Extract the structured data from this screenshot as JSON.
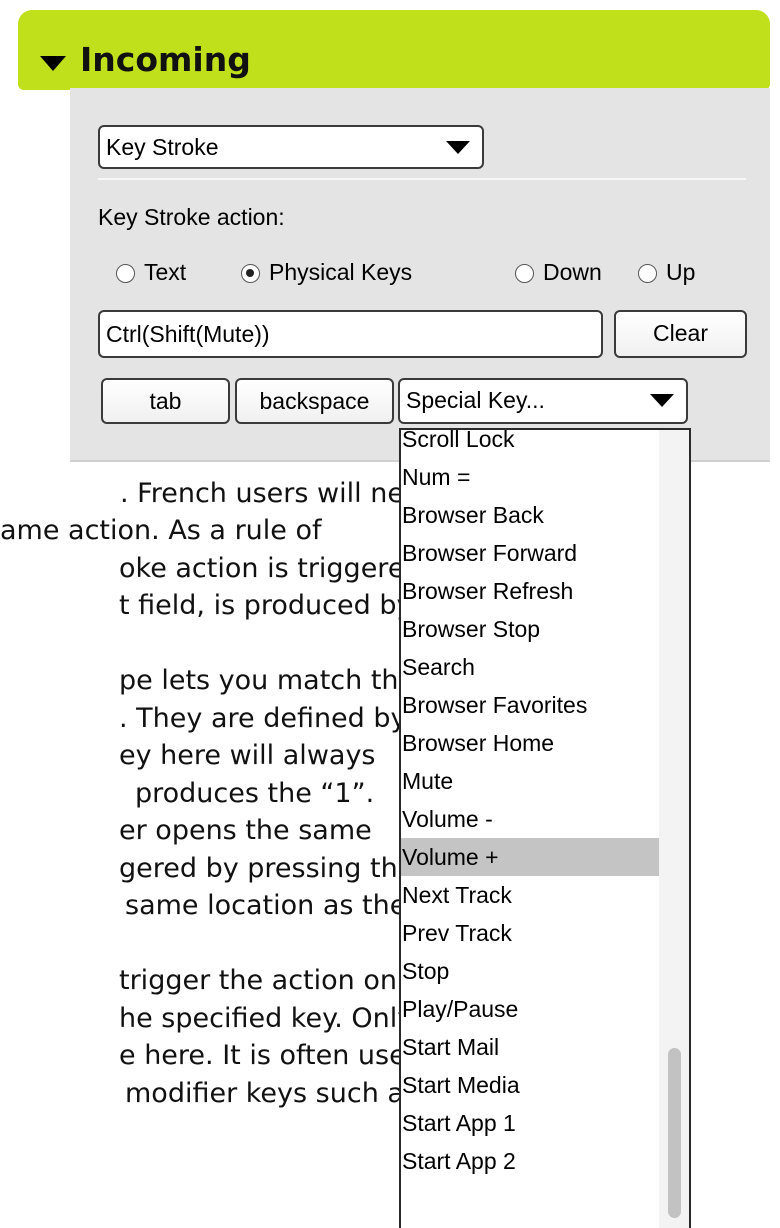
{
  "incoming": {
    "title": "Incoming",
    "action_type": "Key Stroke",
    "action_label": "Key Stroke action:",
    "radio_options": [
      {
        "label": "Text",
        "selected": false
      },
      {
        "label": "Physical Keys",
        "selected": true
      },
      {
        "label": "Down",
        "selected": false
      },
      {
        "label": "Up",
        "selected": false
      }
    ],
    "keystroke_value": "Ctrl(Shift(Mute))",
    "clear_label": "Clear",
    "tab_label": "tab",
    "backspace_label": "backspace",
    "special_key_value": "Special Key..."
  },
  "special_key_menu": {
    "items": [
      "Scroll Lock",
      "Num =",
      "Browser Back",
      "Browser Forward",
      "Browser Refresh",
      "Browser Stop",
      "Search",
      "Browser Favorites",
      "Browser Home",
      "Mute",
      "Volume -",
      "Volume +",
      "Next Track",
      "Prev Track",
      "Stop",
      "Play/Pause",
      "Start Mail",
      "Start Media",
      "Start App 1",
      "Start App 2"
    ],
    "highlighted": "Volume +"
  },
  "body_text": [
    ". French users will need",
    "ame action. As a rule of",
    "oke action is triggered",
    "t field, is produced by",
    "pe lets you match the",
    ". They are defined by",
    "ey here will always",
    " produces the “1”.",
    "er opens the same",
    "gered by pressing the",
    "same location as the",
    "trigger the action on",
    "he specified key. Only",
    "e here. It is often used",
    "modifier keys such as"
  ],
  "colors": {
    "header": "#bfe01a",
    "panel": "#e4e4e4",
    "highlight": "#c4c4c4"
  }
}
